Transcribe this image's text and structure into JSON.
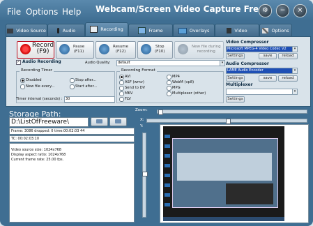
{
  "window": {
    "title": "Webcam/Screen Video Capture Free",
    "menu": [
      "File",
      "Options",
      "Help"
    ]
  },
  "tabs": [
    {
      "label": "Video Source",
      "icon": "camera-icon"
    },
    {
      "label": "Audio",
      "icon": "microphone-icon"
    },
    {
      "label": "Recording",
      "icon": "recording-icon"
    },
    {
      "label": "Frame Grabber",
      "icon": "image-icon"
    },
    {
      "label": "Overlays",
      "icon": "layers-icon"
    },
    {
      "label": "Video Processing",
      "icon": "video-edit-icon"
    },
    {
      "label": "Options",
      "icon": "tools-icon"
    }
  ],
  "recording": {
    "buttons": [
      {
        "label1": "Record",
        "label2": "(F9)",
        "icon": "record-icon"
      },
      {
        "label1": "Pause",
        "label2": "(F11)",
        "icon": "pause-icon"
      },
      {
        "label1": "Resume",
        "label2": "(F12)",
        "icon": "resume-icon"
      },
      {
        "label1": "Stop",
        "label2": "(F10)",
        "icon": "stop-icon"
      },
      {
        "label1": "New file during",
        "label2": "recording",
        "icon": "new-file-icon"
      }
    ],
    "audio_recording_label": "Audio Recording",
    "audio_quality_label": "Audio Quality:",
    "audio_quality_value": "default",
    "timer": {
      "title": "Recording Timer",
      "options": [
        "Disabled",
        "New file every...",
        "Stop after...",
        "Start after..."
      ],
      "selected": "Disabled",
      "interval_label": "Timer interval (seconds) :",
      "interval_value": "30"
    },
    "format": {
      "title": "Recording Format",
      "options": [
        "AVI",
        "ASF (wmv)",
        "Send to DV",
        "MKV",
        "FLV",
        "MP4",
        "WebM (vp8)",
        "MPG",
        "Multiplexer (other)"
      ],
      "selected": "AVI"
    },
    "video_compressor": {
      "title": "Video Compressor",
      "value": "Microsoft MPEG-4 Video Codec V2",
      "buttons": [
        "Settings",
        "save",
        "reload"
      ]
    },
    "audio_compressor": {
      "title": "Audio Compressor",
      "value": "LAME Audio Encoder",
      "buttons": [
        "Settings",
        "save",
        "reload"
      ]
    },
    "multiplexer": {
      "title": "Multiplexer",
      "value": "",
      "buttons": [
        "Settings"
      ]
    }
  },
  "storage": {
    "label": "Storage Path:",
    "path": "D:\\ListOfFreeware\\",
    "open_folder_icon": "folder-open-icon",
    "browse_icon": "folder-browse-icon",
    "frame_info": "Frame: 3086 dropped: 0 time:00:02:03 44",
    "tc": "TC: 00:02:03:10",
    "details": [
      "Video source size: 1024x768",
      "Display aspect ratio: 1024x768",
      "Current frame rate: 25.00 fps."
    ]
  },
  "preview": {
    "zoom_label": "Zoom:",
    "x_label": "X:",
    "y_label": "Y:"
  },
  "colors": {
    "window": "#3f6e92",
    "panel": "#d9e3ea",
    "accent_blue": "#1e4fb5",
    "record_red": "#d11b1b"
  }
}
